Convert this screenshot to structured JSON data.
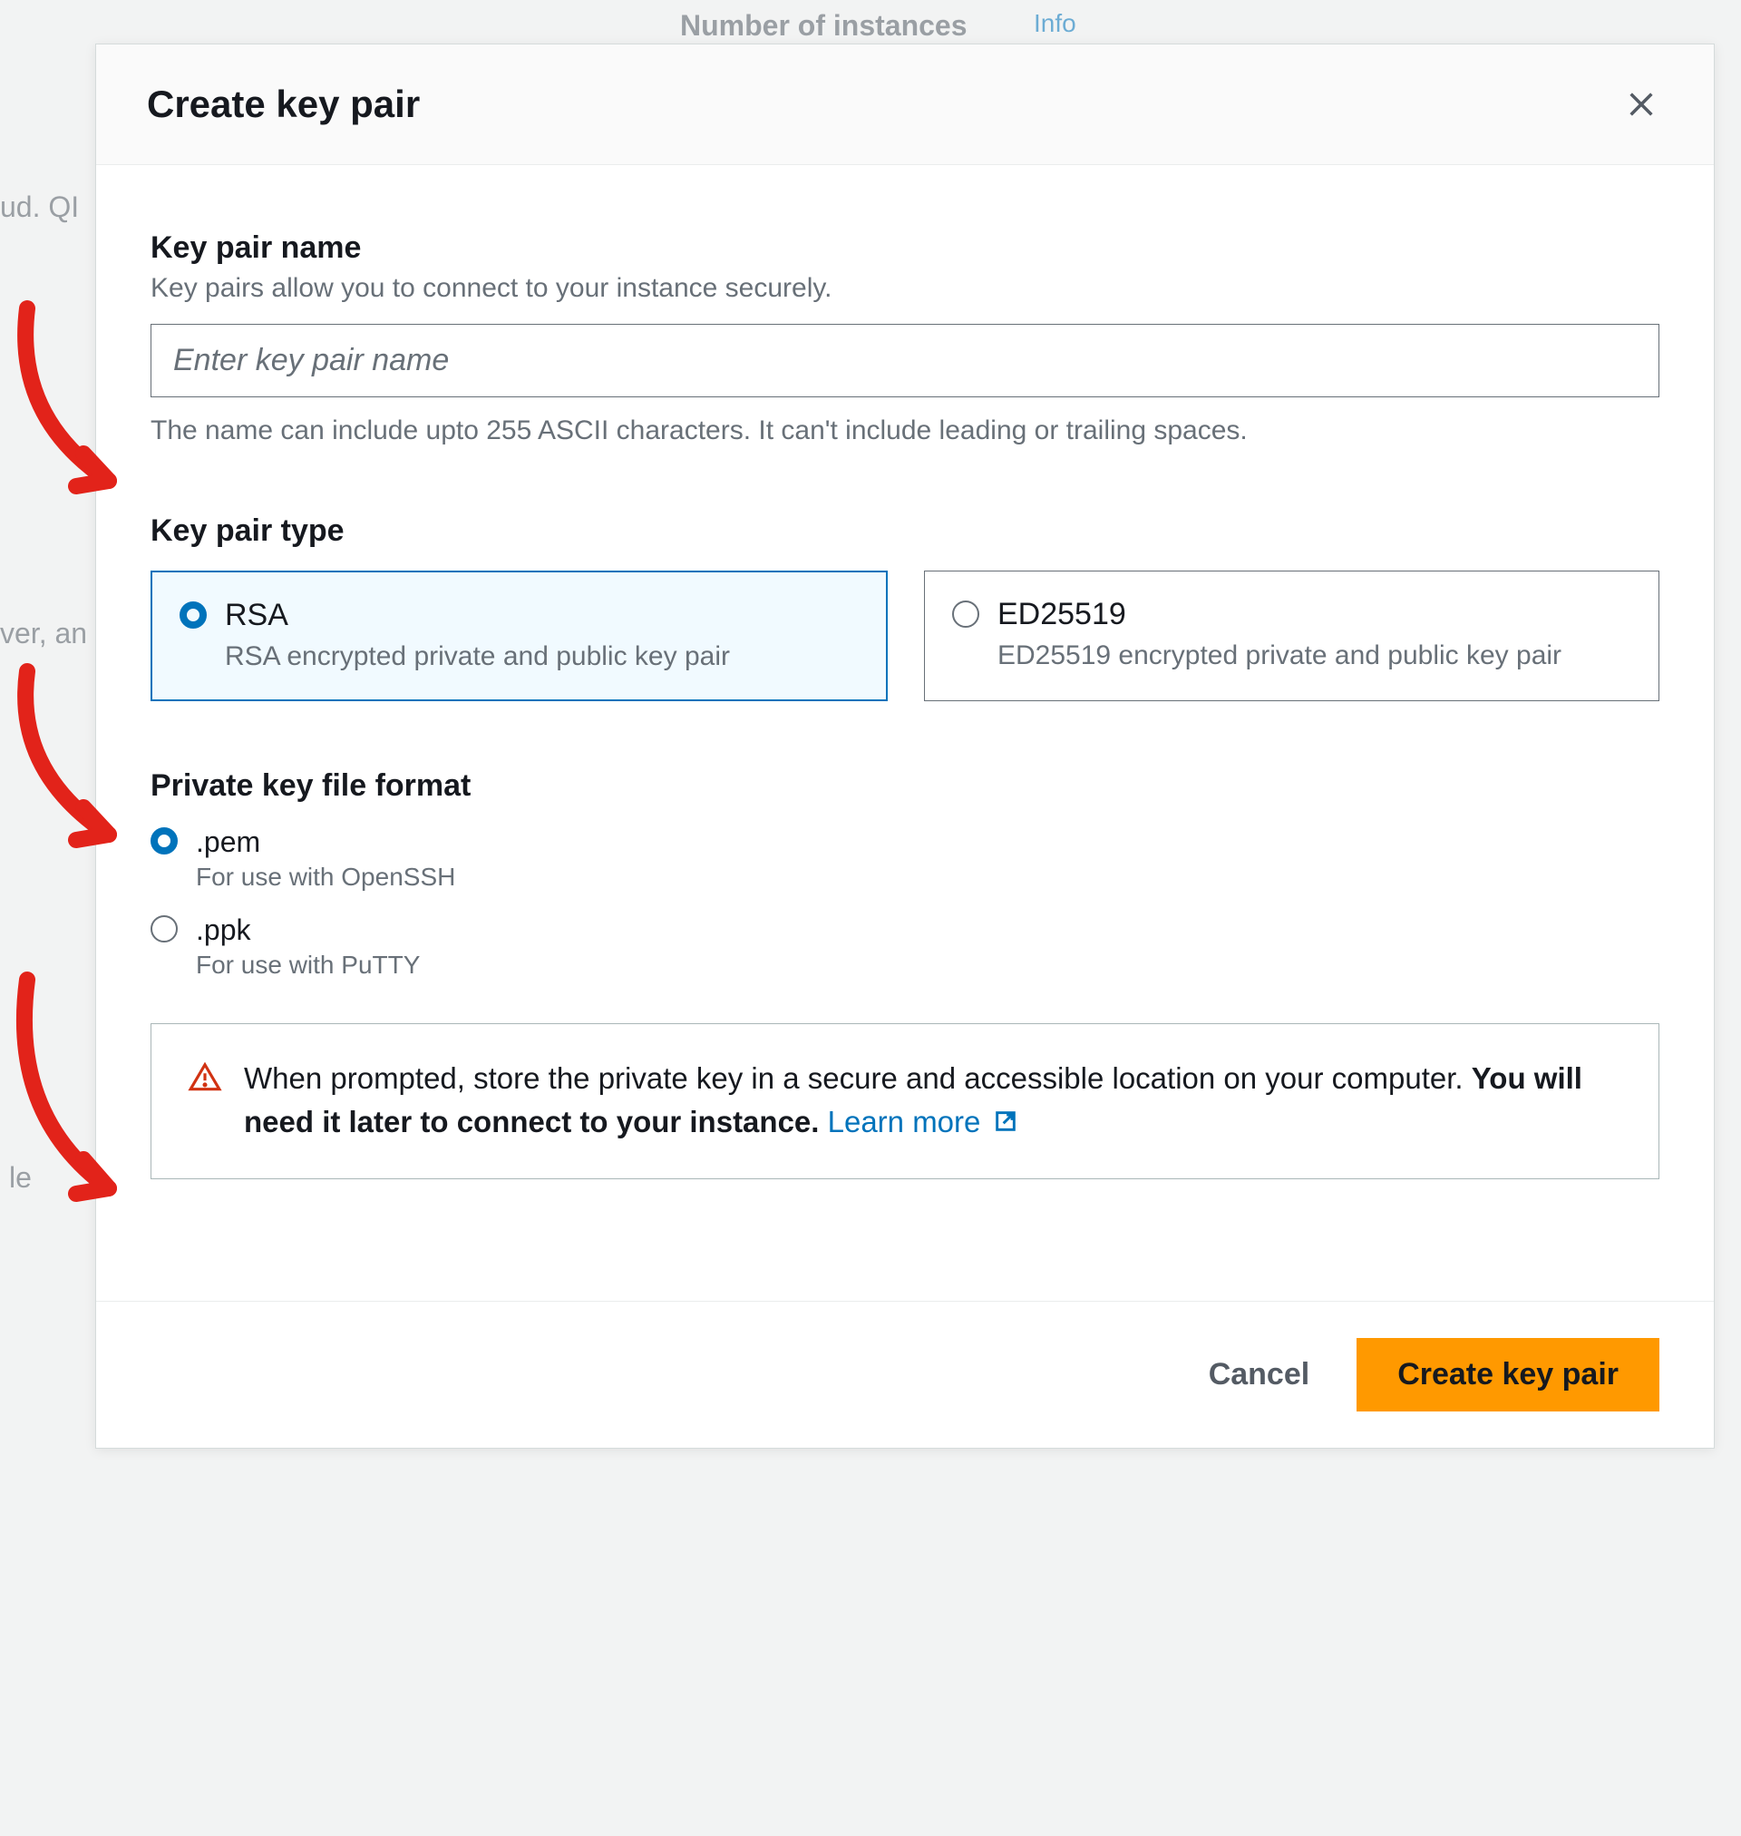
{
  "background": {
    "title": "Number of instances",
    "info": "Info",
    "left1": "ud. QI",
    "left2": "ver, an",
    "left3": "le"
  },
  "modal": {
    "title": "Create key pair",
    "name_section": {
      "label": "Key pair name",
      "description": "Key pairs allow you to connect to your instance securely.",
      "placeholder": "Enter key pair name",
      "help": "The name can include upto 255 ASCII characters. It can't include leading or trailing spaces."
    },
    "type_section": {
      "label": "Key pair type",
      "options": [
        {
          "title": "RSA",
          "description": "RSA encrypted private and public key pair",
          "selected": true
        },
        {
          "title": "ED25519",
          "description": "ED25519 encrypted private and public key pair",
          "selected": false
        }
      ]
    },
    "format_section": {
      "label": "Private key file format",
      "options": [
        {
          "title": ".pem",
          "description": "For use with OpenSSH",
          "selected": true
        },
        {
          "title": ".ppk",
          "description": "For use with PuTTY",
          "selected": false
        }
      ]
    },
    "alert": {
      "text_before": "When prompted, store the private key in a secure and accessible location on your computer. ",
      "text_bold": "You will need it later to connect to your instance.",
      "link": "Learn more"
    },
    "footer": {
      "cancel": "Cancel",
      "submit": "Create key pair"
    }
  }
}
